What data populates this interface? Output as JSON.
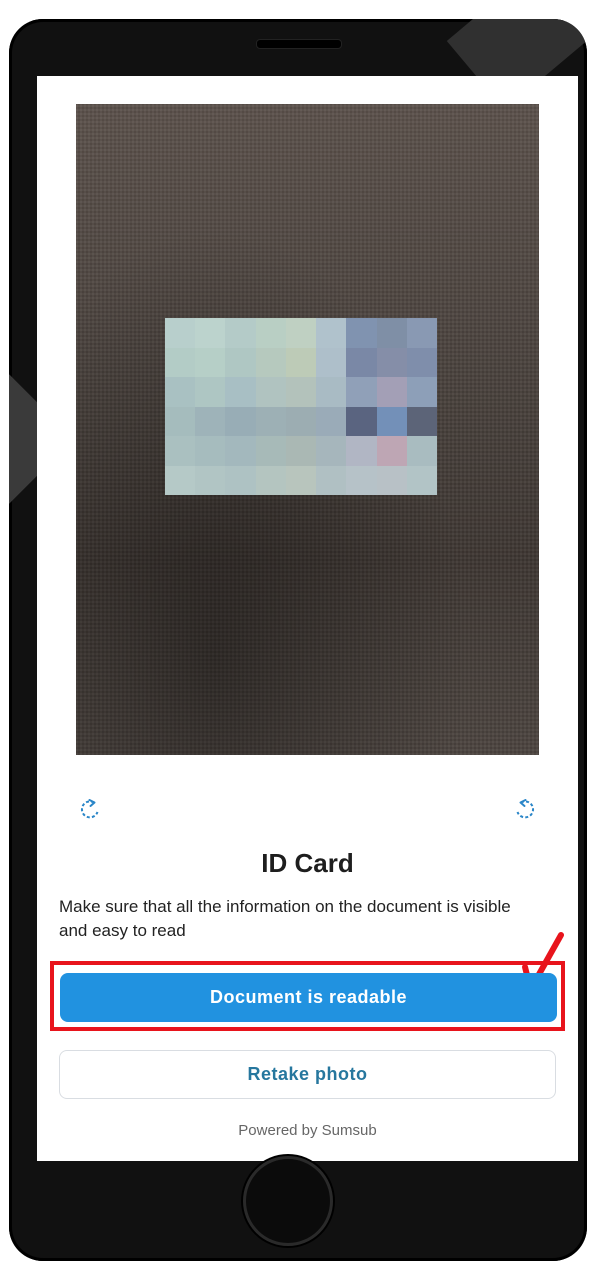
{
  "document": {
    "title": "ID Card",
    "instructions": "Make sure that all the information on the document is visible and easy to read"
  },
  "actions": {
    "confirm_label": "Document is readable",
    "retake_label": "Retake photo"
  },
  "footer": {
    "powered_by": "Powered by Sumsub"
  },
  "icons": {
    "rotate_left": "rotate-counterclockwise-icon",
    "rotate_right": "rotate-clockwise-icon",
    "annotation_arrow": "arrow-down-left-icon"
  },
  "colors": {
    "primary_button": "#2192e0",
    "secondary_text": "#26779e",
    "highlight": "#e8141c",
    "icon": "#2a86c8"
  }
}
